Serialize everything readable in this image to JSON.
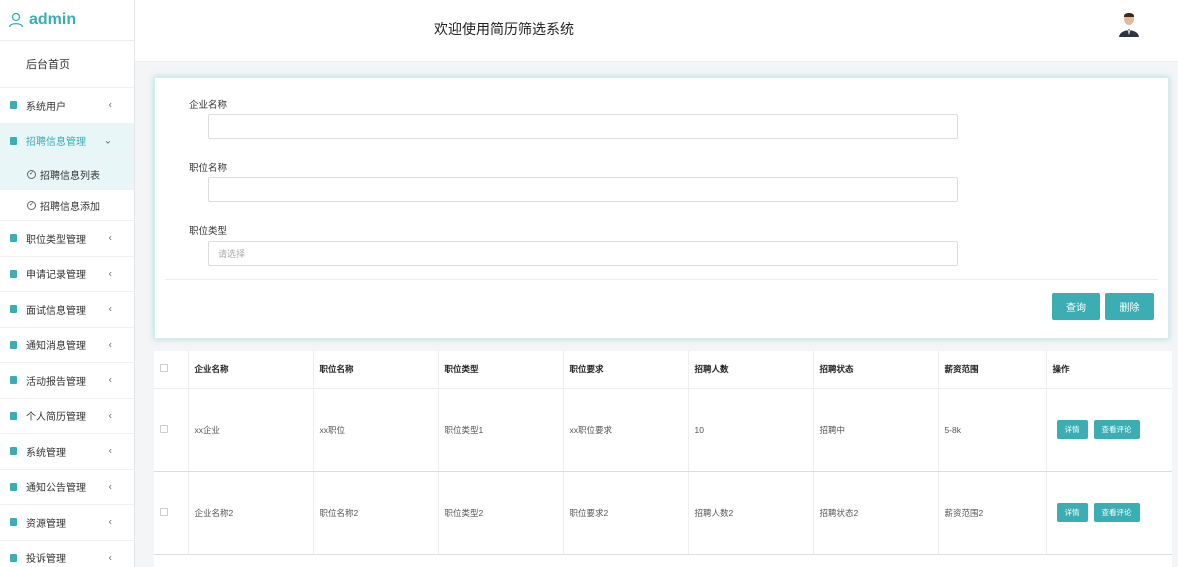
{
  "sidebar": {
    "brand": "admin",
    "home": "后台首页",
    "menu": [
      {
        "label": "系统用户",
        "arrow": "‹"
      },
      {
        "label": "招聘信息管理",
        "arrow": "⌄",
        "active": true
      },
      {
        "label": "职位类型管理",
        "arrow": "‹"
      },
      {
        "label": "申请记录管理",
        "arrow": "‹"
      },
      {
        "label": "面试信息管理",
        "arrow": "‹"
      },
      {
        "label": "通知消息管理",
        "arrow": "‹"
      },
      {
        "label": "活动报告管理",
        "arrow": "‹"
      },
      {
        "label": "个人简历管理",
        "arrow": "‹"
      },
      {
        "label": "系统管理",
        "arrow": "‹"
      },
      {
        "label": "通知公告管理",
        "arrow": "‹"
      },
      {
        "label": "资源管理",
        "arrow": "‹"
      },
      {
        "label": "投诉管理",
        "arrow": "‹"
      }
    ],
    "submenu": [
      "招聘信息列表",
      "招聘信息添加"
    ]
  },
  "header": {
    "title": "欢迎使用简历筛选系统"
  },
  "search": {
    "company_label": "企业名称",
    "position_label": "职位名称",
    "type_label": "职位类型",
    "type_placeholder": "请选择",
    "query_button": "查询",
    "delete_button": "删除"
  },
  "table": {
    "headers": [
      "企业名称",
      "职位名称",
      "职位类型",
      "职位要求",
      "招聘人数",
      "招聘状态",
      "薪资范围",
      "操作"
    ],
    "rows": [
      [
        "xx企业",
        "xx职位",
        "职位类型1",
        "xx职位要求",
        "10",
        "招聘中",
        "5-8k"
      ],
      [
        "企业名称2",
        "职位名称2",
        "职位类型2",
        "职位要求2",
        "招聘人数2",
        "招聘状态2",
        "薪资范围2"
      ]
    ],
    "detail_button": "详情",
    "review_button": "查看评论"
  }
}
